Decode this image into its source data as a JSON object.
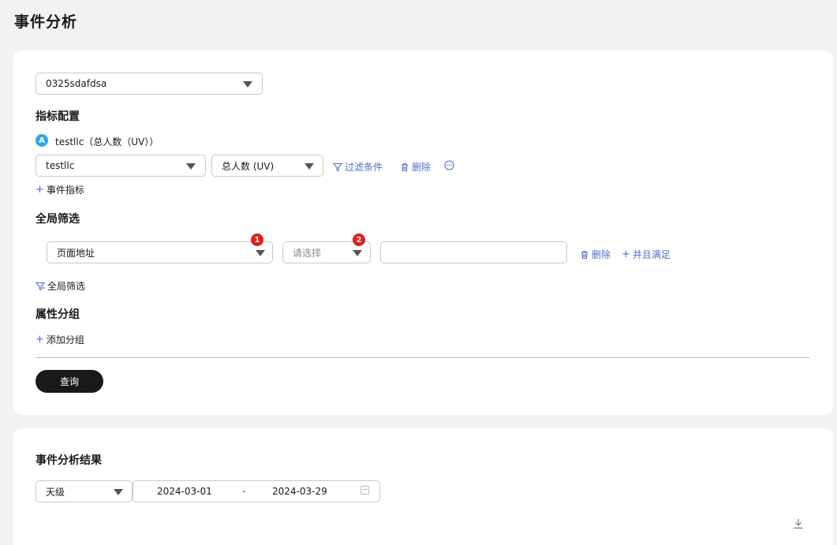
{
  "page": {
    "title": "事件分析"
  },
  "config": {
    "event_select": {
      "value": "0325sdafdsa"
    },
    "metric_section": {
      "title": "指标配置",
      "metric": {
        "badge": "A",
        "label": "testllc（总人数（UV））",
        "event_value": "testllc",
        "measure_value": "总人数 (UV)",
        "filter_label": "过滤条件",
        "delete_label": "删除"
      },
      "add_metric_label": "事件指标"
    },
    "global_filter": {
      "title": "全局筛选",
      "property_value": "页面地址",
      "operator_placeholder": "请选择",
      "value_input": "",
      "badge1": "1",
      "badge2": "2",
      "delete_label": "删除",
      "and_label": "并且满足",
      "add_filter_label": "全局筛选"
    },
    "group": {
      "title": "属性分组",
      "add_group_label": "添加分组"
    },
    "query_button": "查询"
  },
  "result": {
    "title": "事件分析结果",
    "granularity": "天级",
    "date_start": "2024-03-01",
    "date_sep": "-",
    "date_end": "2024-03-29"
  },
  "colors": {
    "link": "#526ecc",
    "badge_a": "#2fa8e8",
    "badge_num": "#e41d1d",
    "button": "#191919"
  },
  "icons": [
    "chevron-down-icon",
    "filter-icon",
    "trash-icon",
    "more-icon",
    "plus-icon",
    "calendar-icon",
    "download-icon"
  ]
}
